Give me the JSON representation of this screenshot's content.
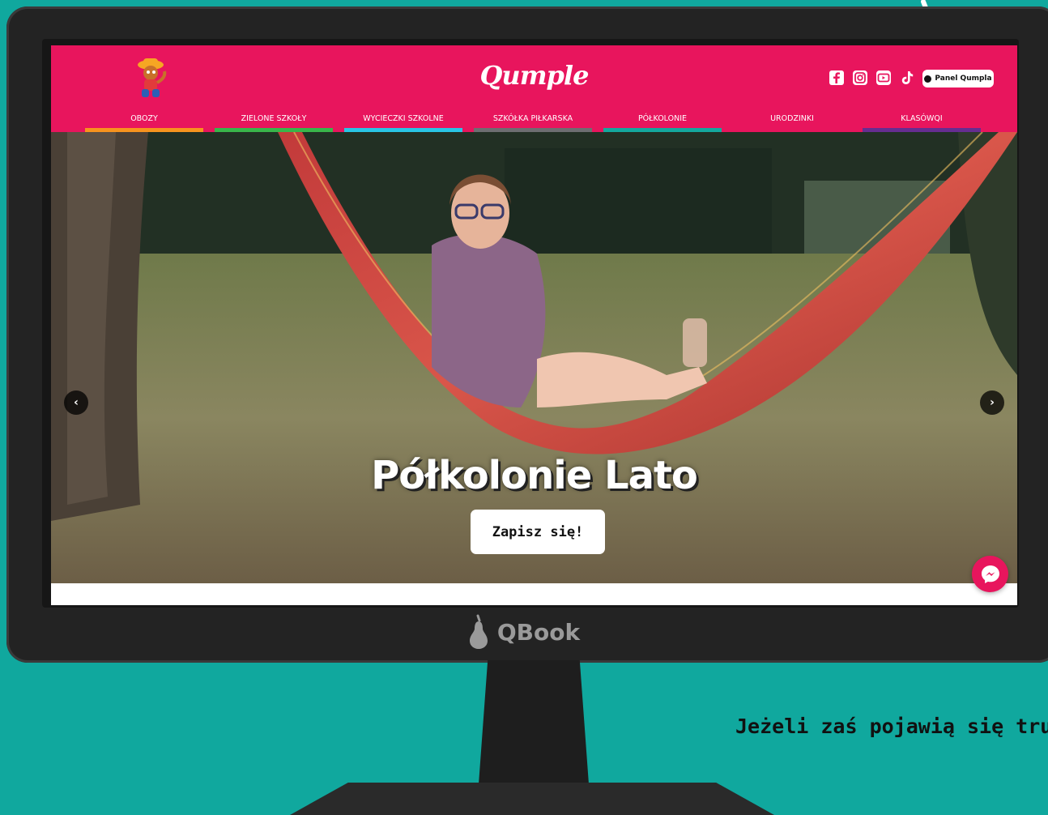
{
  "site": {
    "title": "Qumple",
    "panel_button_label": "Panel Qumpla",
    "nav": [
      {
        "label": "OBOZY",
        "color": "#f7931e"
      },
      {
        "label": "ZIELONE SZKOŁY",
        "color": "#39b54a"
      },
      {
        "label": "WYCIECZKI SZKOLNE",
        "color": "#29c5e6"
      },
      {
        "label": "SZKÓŁKA PIŁKARSKA",
        "color": "#6d6e71"
      },
      {
        "label": "PÓŁKOLONIE",
        "color": "#14a89e"
      },
      {
        "label": "URODZINKI",
        "color": "#e8155d"
      },
      {
        "label": "KLASÓWQI",
        "color": "#662d91"
      }
    ],
    "socials": [
      "facebook-icon",
      "instagram-icon",
      "youtube-icon",
      "tiktok-icon"
    ],
    "brand_color": "#e8155d"
  },
  "hero": {
    "title": "Półkolonie Lato",
    "cta_label": "Zapisz się!"
  },
  "monitor": {
    "brand_label": "QBook"
  },
  "caption": {
    "text": "Jeżeli zaś pojawią się trud"
  }
}
